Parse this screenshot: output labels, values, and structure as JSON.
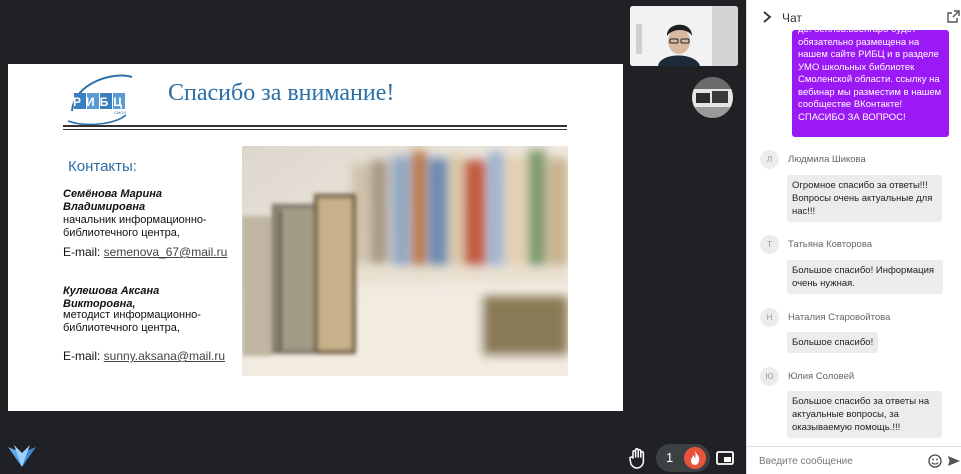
{
  "slide": {
    "logo_text": "РИБЦ",
    "logo_subtext": "СМОЛ",
    "title": "Спасибо за внимание!",
    "contacts_heading": "Контакты:",
    "contacts": [
      {
        "name": "Семёнова  Марина Владимировна",
        "role": "начальник  информационно-библиотечного  центра,",
        "email_label": "E-mail: ",
        "email": "semenova_67@mail.ru"
      },
      {
        "name": "Кулешова Аксана Викторовна,",
        "role": "методист информационно-библиотечного центра,",
        "email_label": "E-mail: ",
        "email": "sunny.aksana@mail.ru"
      }
    ]
  },
  "controls": {
    "reaction_count": "1"
  },
  "chat": {
    "title": "Чат",
    "own_message": "до. бенлов.воeнrapo бyдет обязательно размещена на нашем сайте РИБЦ и в разделе УМО школьных библиотек Смоленской области. ссылку на вебинар мы разместим в нашем сообществе ВКонтакте! СПАСИБО ЗА ВОПРОС!",
    "messages": [
      {
        "initial": "Л",
        "author": "Людмила Шикова",
        "text": "Огромное спасибо за ответы!!! Вопросы очень актуальные для нас!!!"
      },
      {
        "initial": "Т",
        "author": "Татьяна Ковторова",
        "text": "Большое спасибо!  Информация очень нужная."
      },
      {
        "initial": "Н",
        "author": "Наталия Старовойтова",
        "text": "Большое спасибо!"
      },
      {
        "initial": "Ю",
        "author": "Юлия Соловей",
        "text": "Большое спасибо за  ответы на актуальные вопросы,  за оказываемую помощь.!!!"
      }
    ],
    "input_placeholder": "Введите сообщение"
  },
  "colors": {
    "stage_bg": "#202124",
    "slide_title": "#2a6fa8",
    "own_bubble": "#9b19f5",
    "other_bubble": "#ececec"
  }
}
